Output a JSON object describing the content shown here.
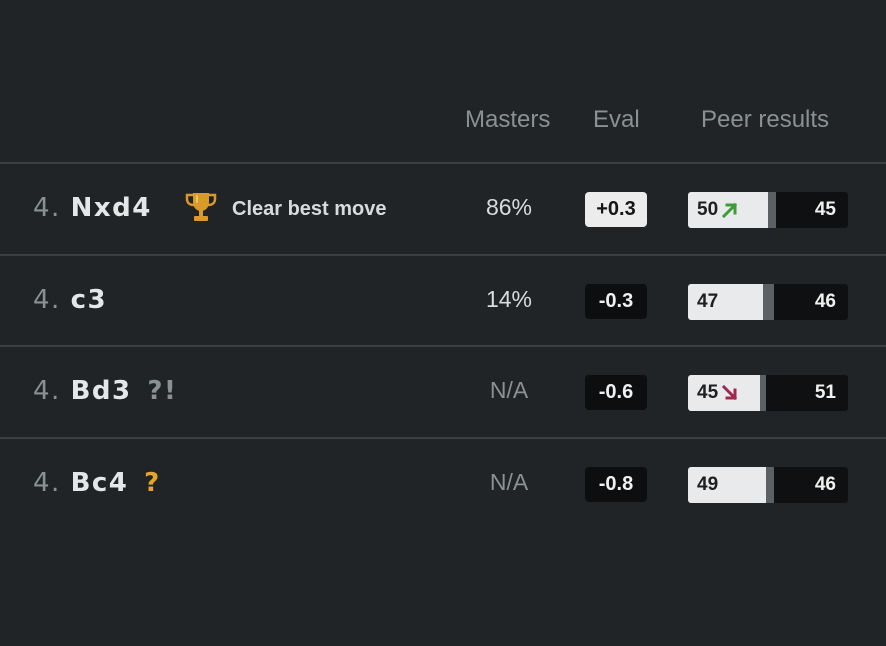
{
  "header": {
    "masters": "Masters",
    "eval": "Eval",
    "peer_results": "Peer results"
  },
  "rows": [
    {
      "number": "4.",
      "move": "Nxd4",
      "annotation": "",
      "badge": {
        "icon": "trophy-icon",
        "text": "Clear best move"
      },
      "masters": "86%",
      "eval": "+0.3",
      "eval_favors": "white",
      "peer": {
        "white": "50",
        "draw_pct": 5,
        "black": "45",
        "trend": "up"
      }
    },
    {
      "number": "4.",
      "move": "c3",
      "annotation": "",
      "masters": "14%",
      "eval": "-0.3",
      "eval_favors": "black",
      "peer": {
        "white": "47",
        "draw_pct": 7,
        "black": "46",
        "trend": ""
      }
    },
    {
      "number": "4.",
      "move": "Bd3",
      "annotation": "?!",
      "masters": "N/A",
      "eval": "-0.6",
      "eval_favors": "black",
      "peer": {
        "white": "45",
        "draw_pct": 4,
        "black": "51",
        "trend": "down"
      }
    },
    {
      "number": "4.",
      "move": "Bc4",
      "annotation": "?",
      "masters": "N/A",
      "eval": "-0.8",
      "eval_favors": "black",
      "peer": {
        "white": "49",
        "draw_pct": 5,
        "black": "46",
        "trend": ""
      }
    }
  ],
  "colors": {
    "background": "#212426",
    "trend_up": "#3f9a3a",
    "trend_down": "#a0294f",
    "trophy": "#d89a2b",
    "mistake": "#e4a52b"
  }
}
